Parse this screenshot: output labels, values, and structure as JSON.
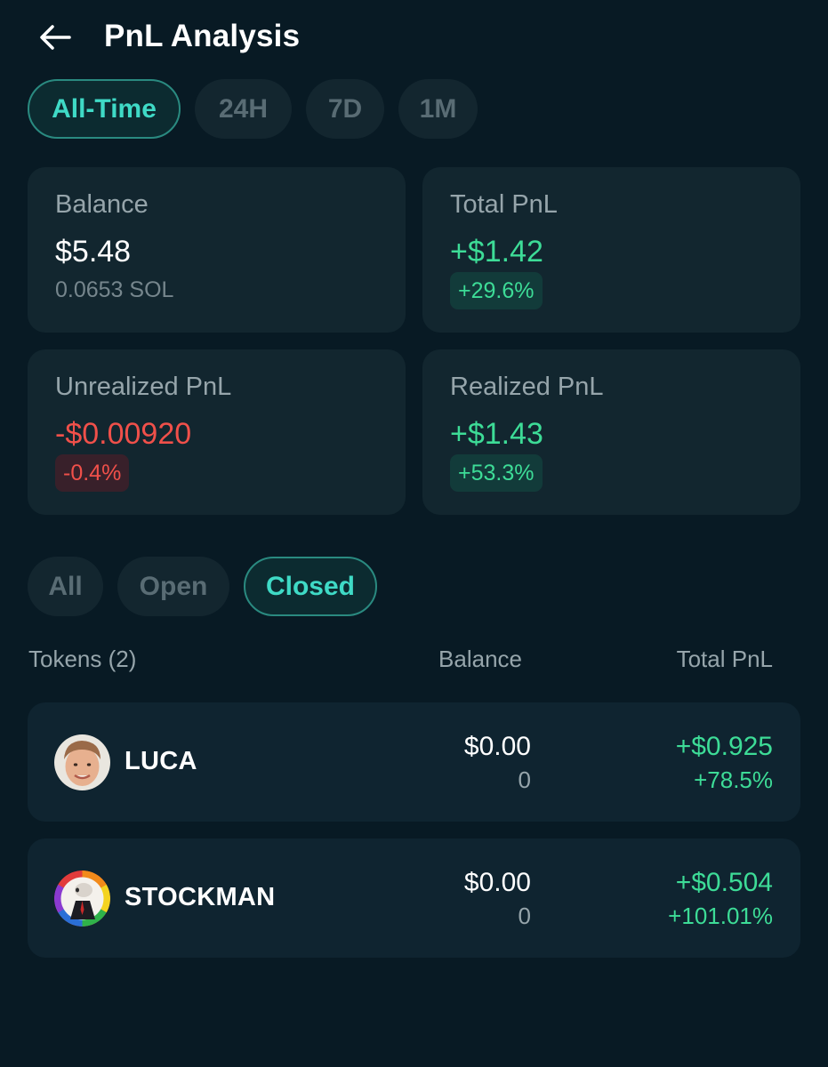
{
  "header": {
    "title": "PnL Analysis",
    "back_icon": "arrow-left-icon"
  },
  "period_tabs": [
    {
      "label": "All-Time",
      "active": true
    },
    {
      "label": "24H",
      "active": false
    },
    {
      "label": "7D",
      "active": false
    },
    {
      "label": "1M",
      "active": false
    }
  ],
  "stats": {
    "balance": {
      "label": "Balance",
      "value": "$5.48",
      "sub": "0.0653 SOL"
    },
    "total_pnl": {
      "label": "Total PnL",
      "value": "+$1.42",
      "badge": "+29.6%"
    },
    "unrealized_pnl": {
      "label": "Unrealized PnL",
      "value": "-$0.00920",
      "badge": "-0.4%"
    },
    "realized_pnl": {
      "label": "Realized PnL",
      "value": "+$1.43",
      "badge": "+53.3%"
    }
  },
  "filter_tabs": [
    {
      "label": "All",
      "active": false
    },
    {
      "label": "Open",
      "active": false
    },
    {
      "label": "Closed",
      "active": true
    }
  ],
  "table": {
    "headers": {
      "tokens": "Tokens (2)",
      "balance": "Balance",
      "total_pnl": "Total PnL"
    },
    "rows": [
      {
        "name": "LUCA",
        "balance_usd": "$0.00",
        "balance_amount": "0",
        "pnl_usd": "+$0.925",
        "pnl_pct": "+78.5%"
      },
      {
        "name": "STOCKMAN",
        "balance_usd": "$0.00",
        "balance_amount": "0",
        "pnl_usd": "+$0.504",
        "pnl_pct": "+101.01%"
      }
    ]
  },
  "colors": {
    "background": "#081a24",
    "card": "#12262f",
    "accent": "#3fdac6",
    "positive": "#3ddc97",
    "negative": "#f0504a"
  }
}
